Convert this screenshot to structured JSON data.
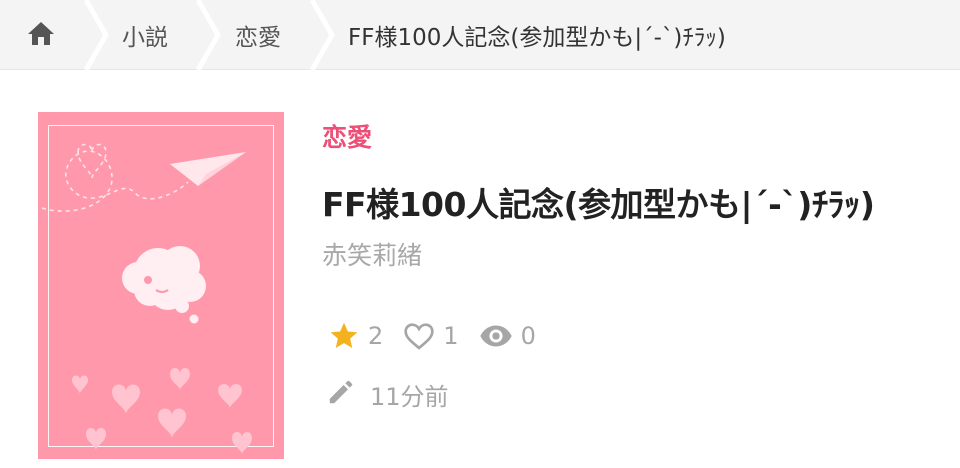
{
  "breadcrumb": {
    "home_icon": "home-icon",
    "items": [
      {
        "label": "小説"
      },
      {
        "label": "恋愛"
      },
      {
        "label": "FF様100人記念(参加型かも|´-`)ﾁﾗｯ)"
      }
    ]
  },
  "book": {
    "genre": "恋愛",
    "title": "FF様100人記念(参加型かも|´-`)ﾁﾗｯ)",
    "author": "赤笑莉緒",
    "cover_color": "#ff98aa",
    "stats": {
      "stars": "2",
      "likes": "1",
      "views": "0"
    },
    "updated": "11分前"
  },
  "colors": {
    "accent": "#ee4f77",
    "star": "#f5b21f",
    "muted": "#a6a6a6"
  }
}
